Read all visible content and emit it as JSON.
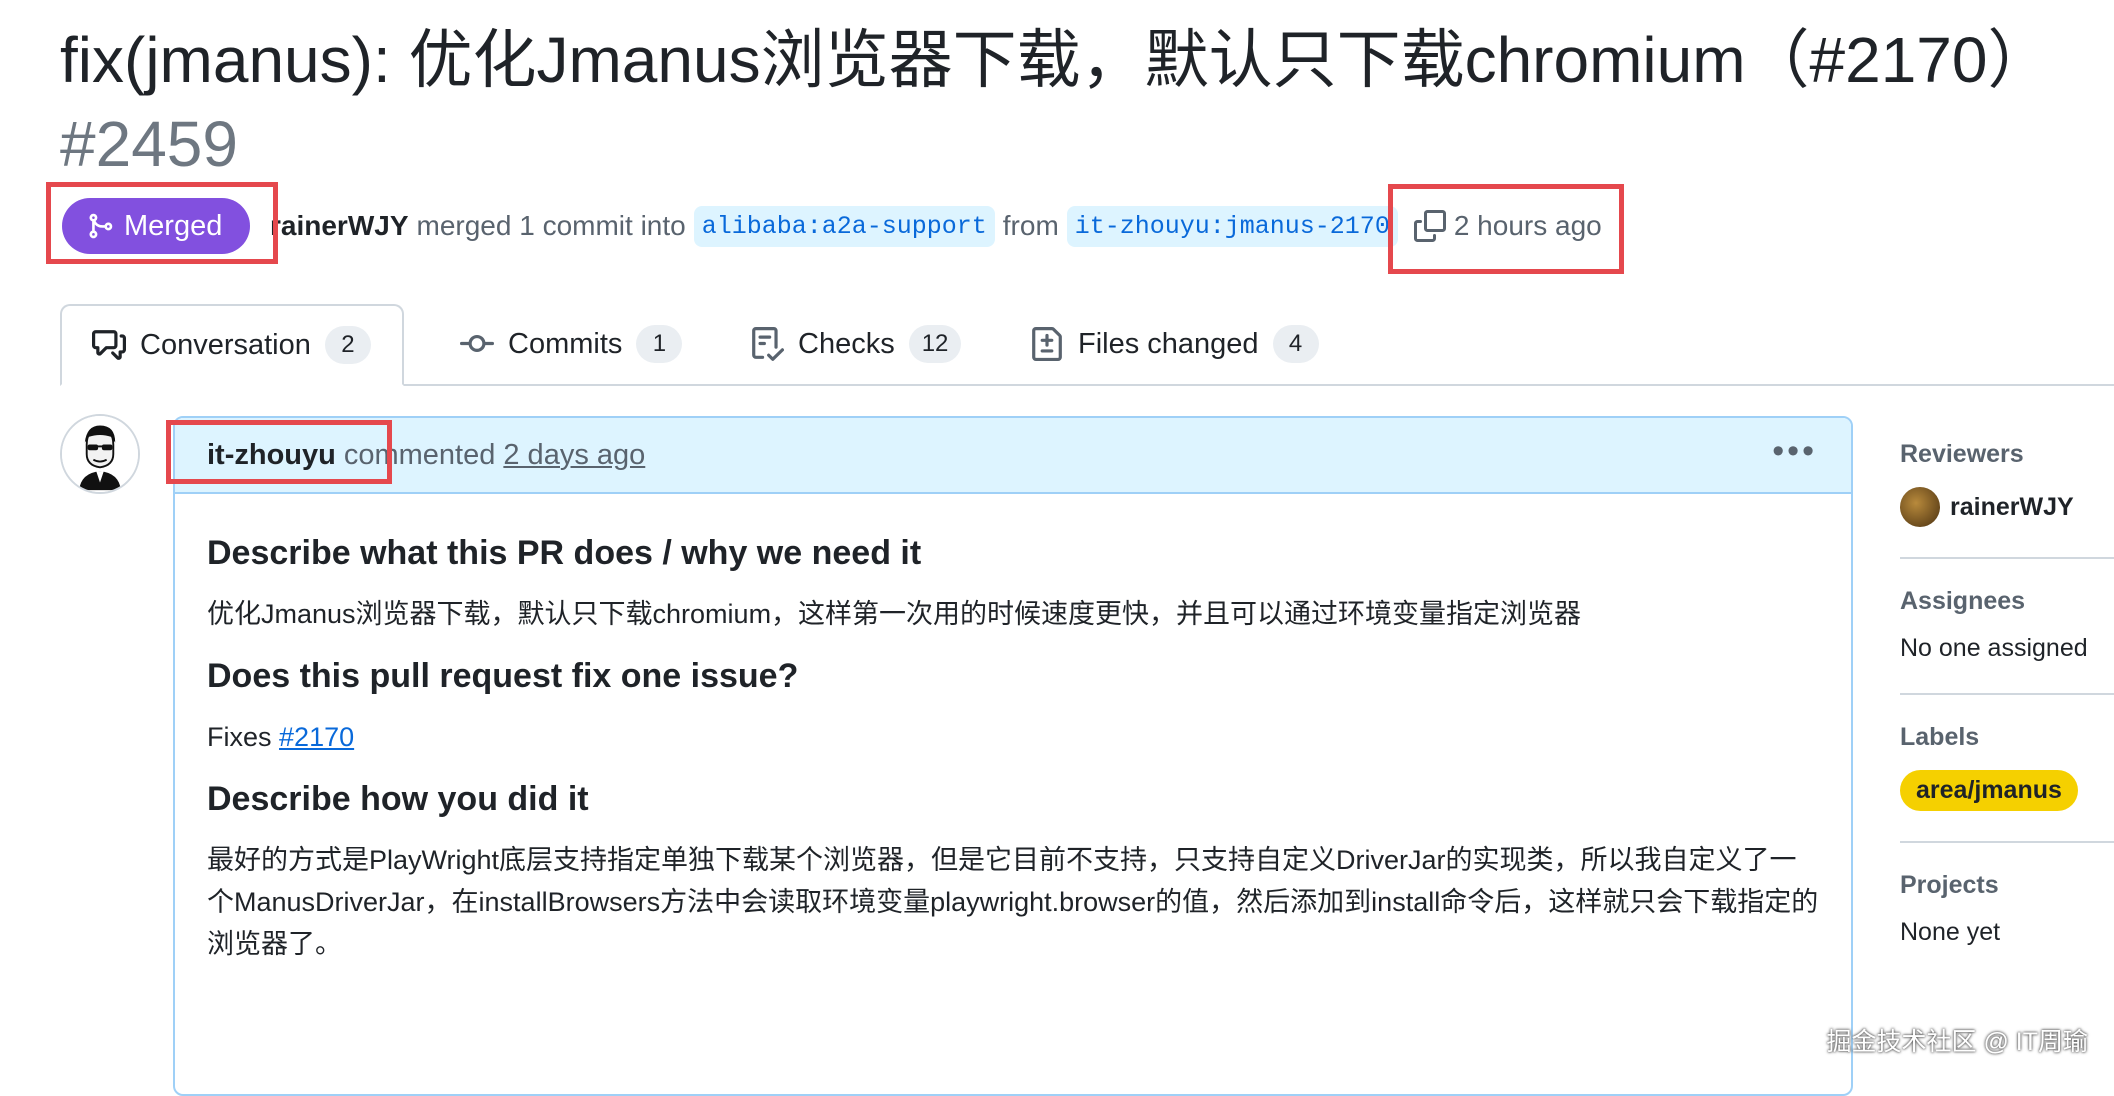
{
  "pr": {
    "title": "fix(jmanus): 优化Jmanus浏览器下载，默认只下载chromium（#2170）",
    "number": "#2459",
    "status": "Merged",
    "author": "rainerWJY",
    "action_text": "merged 1 commit into",
    "base_branch": "alibaba:a2a-support",
    "from_text": "from",
    "head_branch": "it-zhouyu:jmanus-2170",
    "time": "2 hours ago",
    "merge_color": "#8250df"
  },
  "tabs": [
    {
      "label": "Conversation",
      "count": "2",
      "icon": "conversation-icon"
    },
    {
      "label": "Commits",
      "count": "1",
      "icon": "commit-icon"
    },
    {
      "label": "Checks",
      "count": "12",
      "icon": "checks-icon"
    },
    {
      "label": "Files changed",
      "count": "4",
      "icon": "file-diff-icon"
    }
  ],
  "comment": {
    "author": "it-zhouyu",
    "action": "commented",
    "time": "2 days ago",
    "h1": "Describe what this PR does / why we need it",
    "p1": "优化Jmanus浏览器下载，默认只下载chromium，这样第一次用的时候速度更快，并且可以通过环境变量指定浏览器",
    "h2": "Does this pull request fix one issue?",
    "fixes_text": "Fixes",
    "fixes_link": "#2170",
    "h3": "Describe how you did it",
    "p3": "最好的方式是PlayWright底层支持指定单独下载某个浏览器，但是它目前不支持，只支持自定义DriverJar的实现类，所以我自定义了一个ManusDriverJar，在installBrowsers方法中会读取环境变量playwright.browser的值，然后添加到install命令后，这样就只会下载指定的浏览器了。"
  },
  "sidebar": {
    "reviewers_title": "Reviewers",
    "reviewer": "rainerWJY",
    "assignees_title": "Assignees",
    "assignees_value": "No one assigned",
    "labels_title": "Labels",
    "label": "area/jmanus",
    "label_color": "#f5d000",
    "projects_title": "Projects",
    "projects_value": "None yet"
  },
  "watermark": "掘金技术社区 @ IT周瑜"
}
